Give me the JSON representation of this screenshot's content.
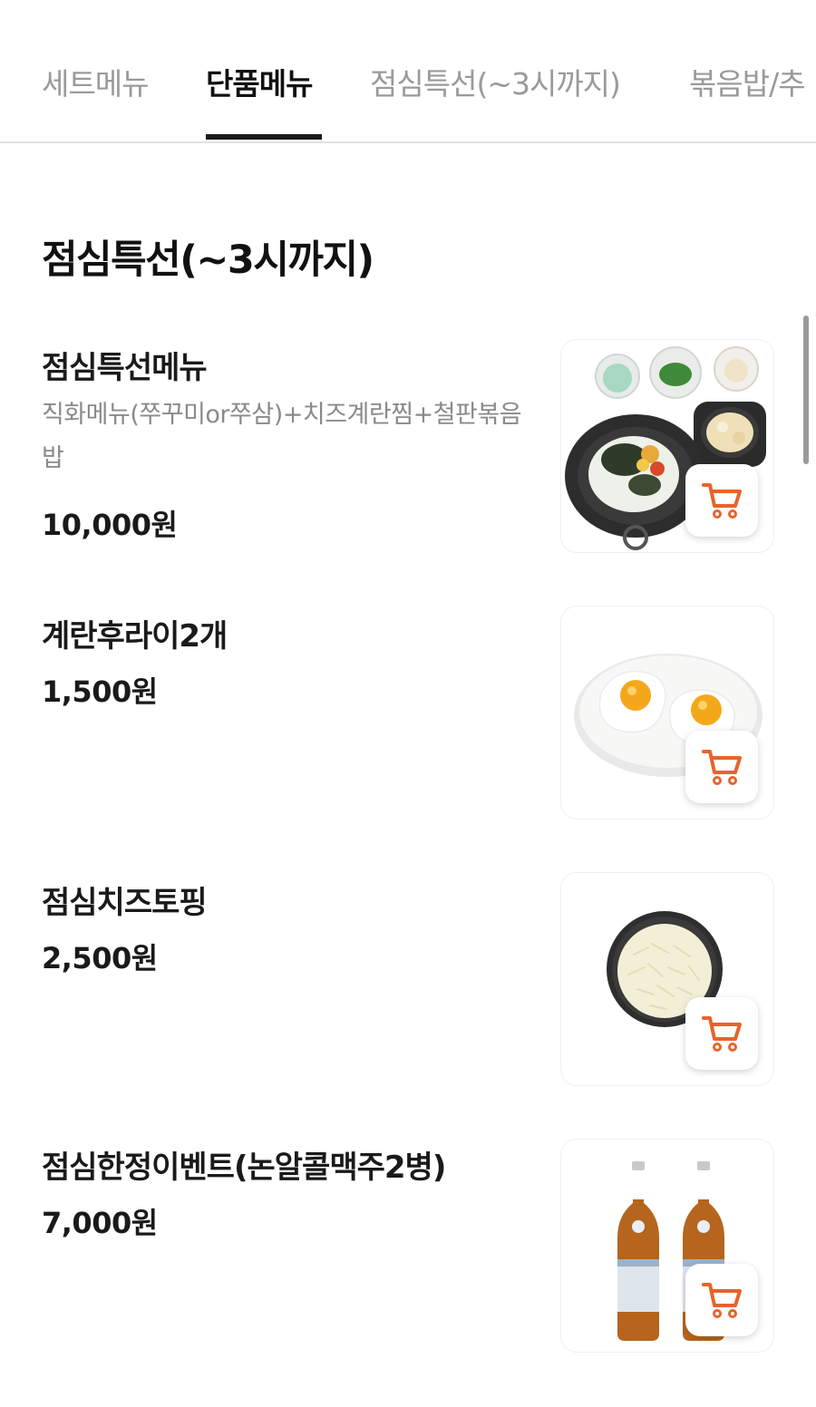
{
  "tabs": [
    {
      "label": "세트메뉴",
      "active": false
    },
    {
      "label": "단품메뉴",
      "active": true
    },
    {
      "label": "점심특선(~3시까지)",
      "active": false
    },
    {
      "label": "볶음밥/추",
      "active": false
    }
  ],
  "section": {
    "title": "점심특선(~3시까지)"
  },
  "items": [
    {
      "name": "점심특선메뉴",
      "description": "직화메뉴(쭈꾸미or쭈삼)+치즈계란찜+철판볶음밥",
      "price": "10,000원",
      "image": "lunch-set-photo"
    },
    {
      "name": "계란후라이2개",
      "price": "1,500원",
      "image": "fried-eggs-photo"
    },
    {
      "name": "점심치즈토핑",
      "price": "2,500원",
      "image": "cheese-topping-photo"
    },
    {
      "name": "점심한정이벤트(논알콜맥주2병)",
      "price": "7,000원",
      "image": "non-alcohol-beer-photo"
    }
  ],
  "icons": {
    "cart": "cart-icon"
  },
  "colors": {
    "accent": "#e8632b",
    "active_tab": "#111111",
    "inactive_tab": "#9a9a9a"
  }
}
